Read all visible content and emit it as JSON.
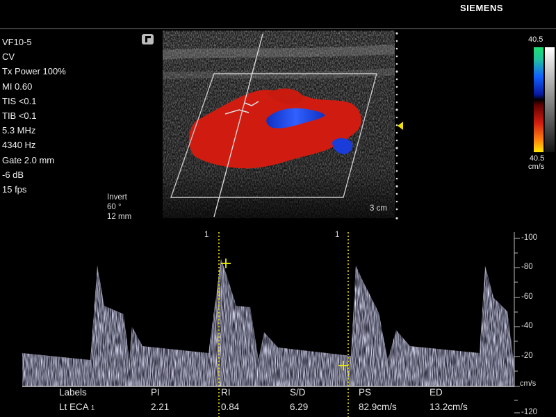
{
  "brand": "SIEMENS",
  "parameters": [
    "VF10-5",
    "CV",
    "Tx Power 100%",
    "MI 0.60",
    "TIS <0.1",
    "TIB <0.1",
    "5.3 MHz",
    "4340 Hz",
    "Gate 2.0 mm",
    "-6 dB",
    "15 fps"
  ],
  "steer": {
    "line1": "Invert",
    "line2": "60 °",
    "line3": "12 mm"
  },
  "depth_label": "3 cm",
  "color_scale": {
    "top": "40.5",
    "bottom": "40.5",
    "unit": "cm/s"
  },
  "doppler": {
    "marker1": "1",
    "marker2": "1",
    "scale": [
      "-100",
      "-80",
      "-60",
      "-40",
      "-20",
      "cm/s",
      "-120"
    ]
  },
  "measurements": {
    "headers": [
      "Labels",
      "PI",
      "RI",
      "S/D",
      "PS",
      "ED"
    ],
    "values": [
      "Lt ECA",
      "2.21",
      "0.84",
      "6.29",
      "82.9cm/s",
      "13.2cm/s"
    ],
    "label_index": "1"
  },
  "colors": {
    "flow_red": "#d01c10",
    "flow_blue": "#1a3cd8",
    "caliper": "#f0f000",
    "gate_line": "#f0e000"
  }
}
